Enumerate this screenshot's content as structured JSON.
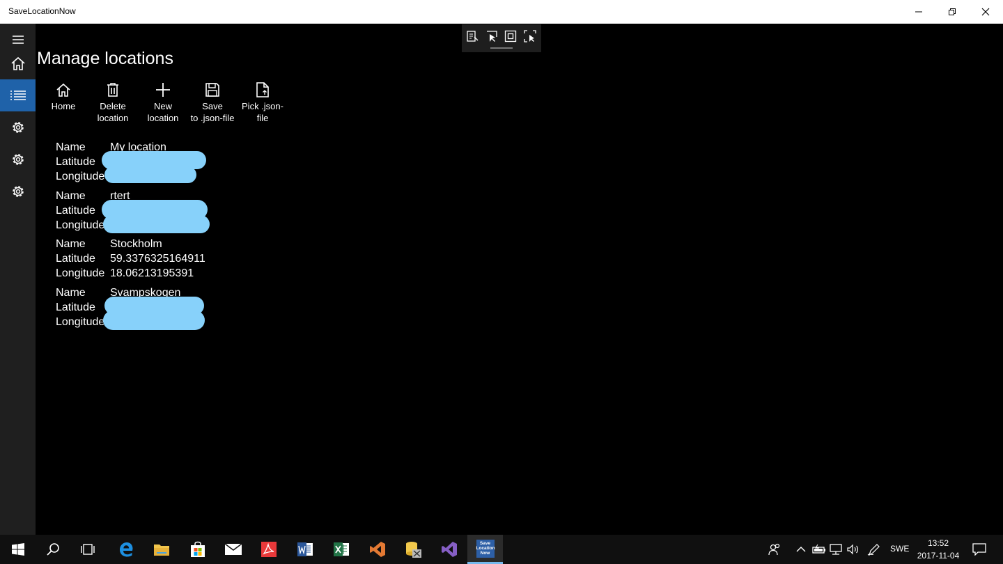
{
  "window": {
    "title": "SaveLocationNow",
    "controls": [
      "minimize-icon",
      "restore-icon",
      "close-icon"
    ]
  },
  "nav": {
    "items": [
      {
        "icon": "hamburger-icon"
      },
      {
        "icon": "home-icon"
      },
      {
        "icon": "list-icon",
        "active": true
      },
      {
        "icon": "gear-icon"
      },
      {
        "icon": "gear-icon"
      },
      {
        "icon": "gear-icon"
      }
    ]
  },
  "page": {
    "title": "Manage locations"
  },
  "commands": [
    {
      "icon": "home-icon",
      "label": "Home"
    },
    {
      "icon": "trash-icon",
      "label": "Delete\nlocation"
    },
    {
      "icon": "plus-icon",
      "label": "New\nlocation"
    },
    {
      "icon": "save-icon",
      "label": "Save\nto .json-file"
    },
    {
      "icon": "open-file-icon",
      "label": "Pick .json-\nfile"
    }
  ],
  "field_labels": {
    "name": "Name",
    "latitude": "Latitude",
    "longitude": "Longitude"
  },
  "locations": [
    {
      "name": "My location",
      "latitude": "",
      "longitude": "",
      "redacted": true
    },
    {
      "name": "rtert",
      "latitude": "",
      "longitude": "",
      "redacted": true
    },
    {
      "name": "Stockholm",
      "latitude": "59.3376325164911",
      "longitude": "18.06213195391",
      "redacted": false
    },
    {
      "name": "Svampskogen",
      "latitude": "",
      "longitude": "",
      "redacted": true
    }
  ],
  "colors": {
    "accent": "#1f62a9",
    "redaction": "#87d1fa",
    "background": "#000000",
    "taskbar": "#101010"
  },
  "taskbar": {
    "active_app_label": "Save\nLocation\nNow",
    "language": "SWE",
    "time": "13:52",
    "date": "2017-11-04"
  }
}
